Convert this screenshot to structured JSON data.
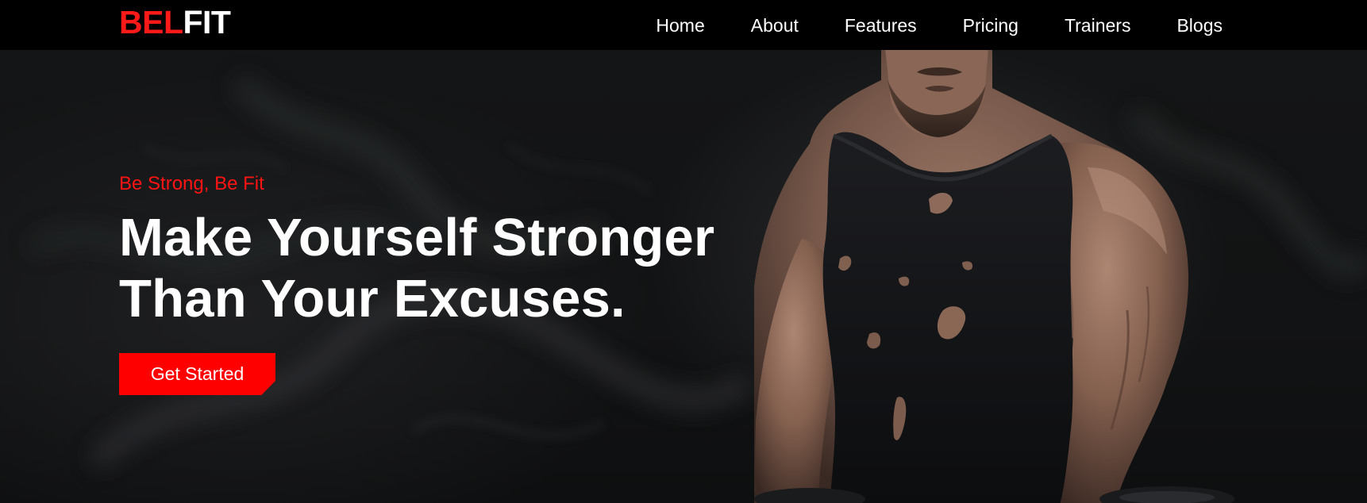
{
  "brand": {
    "logo_red": "BEL",
    "logo_white": "FIT",
    "accent_color": "#ff0000"
  },
  "nav": {
    "items": [
      {
        "label": "Home"
      },
      {
        "label": "About"
      },
      {
        "label": "Features"
      },
      {
        "label": "Pricing"
      },
      {
        "label": "Trainers"
      },
      {
        "label": "Blogs"
      }
    ]
  },
  "hero": {
    "tagline": "Be Strong, Be Fit",
    "headline_line1": "Make Yourself Stronger",
    "headline_line2": "Than Your Excuses.",
    "cta_label": "Get Started"
  }
}
